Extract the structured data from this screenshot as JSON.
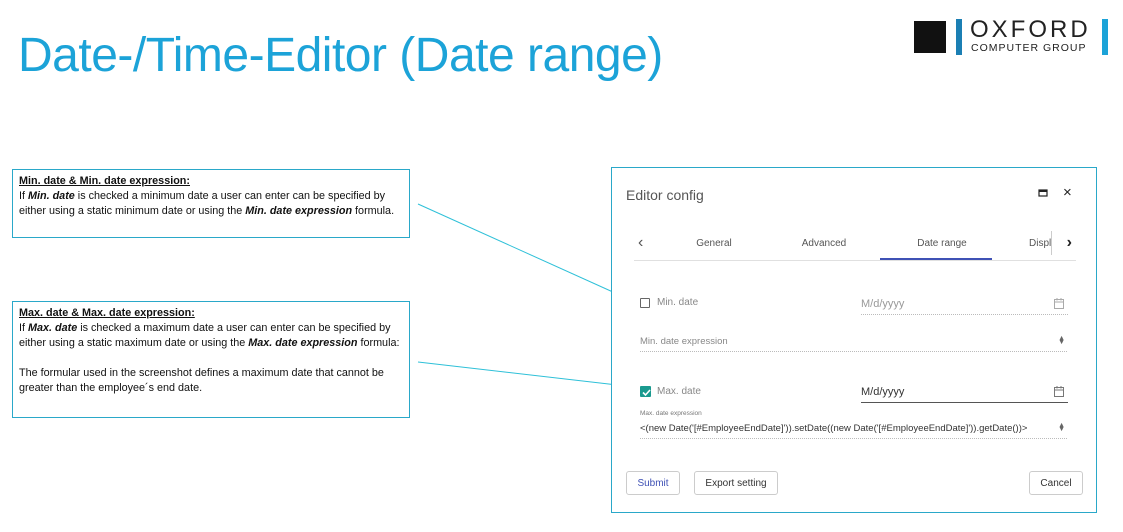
{
  "slide": {
    "title": "Date-/Time-Editor (Date range)",
    "logo": {
      "word": "OXFORD",
      "sub": "COMPUTER GROUP"
    }
  },
  "callouts": {
    "min": {
      "heading": "Min. date & Min. date expression:",
      "p1": "If ",
      "b1": "Min. date",
      "p2": " is checked a minimum date a user can enter can be specified by either using a static minimum date or using the ",
      "b2": "Min. date expression",
      "p3": " formula."
    },
    "max": {
      "heading": "Max. date & Max. date expression:",
      "p1": "If ",
      "b1": "Max. date",
      "p2": " is checked a maximum date a user can enter can be specified by either using a static maximum date or using the ",
      "b2": "Max. date expression",
      "p3": " formula:",
      "p4": "The formular used in the screenshot defines a maximum date that cannot be greater than the employee´s end date."
    }
  },
  "dialog": {
    "title": "Editor config",
    "tabs": {
      "general": "General",
      "advanced": "Advanced",
      "date_range": "Date range",
      "display": "Displ"
    },
    "min_date": {
      "label": "Min. date",
      "placeholder": "M/d/yyyy",
      "checked": false
    },
    "min_expression": {
      "label": "Min. date expression"
    },
    "max_date": {
      "label": "Max. date",
      "value": "M/d/yyyy",
      "checked": true
    },
    "max_expression": {
      "label": "Max. date expression",
      "value": "<(new Date('[#EmployeeEndDate]')).setDate((new Date('[#EmployeeEndDate]')).getDate())>"
    },
    "buttons": {
      "submit": "Submit",
      "export": "Export setting",
      "cancel": "Cancel"
    }
  },
  "colors": {
    "accent": "#1ca3d8",
    "tab_indicator": "#3f51b5",
    "checkbox": "#1a9a8f"
  }
}
